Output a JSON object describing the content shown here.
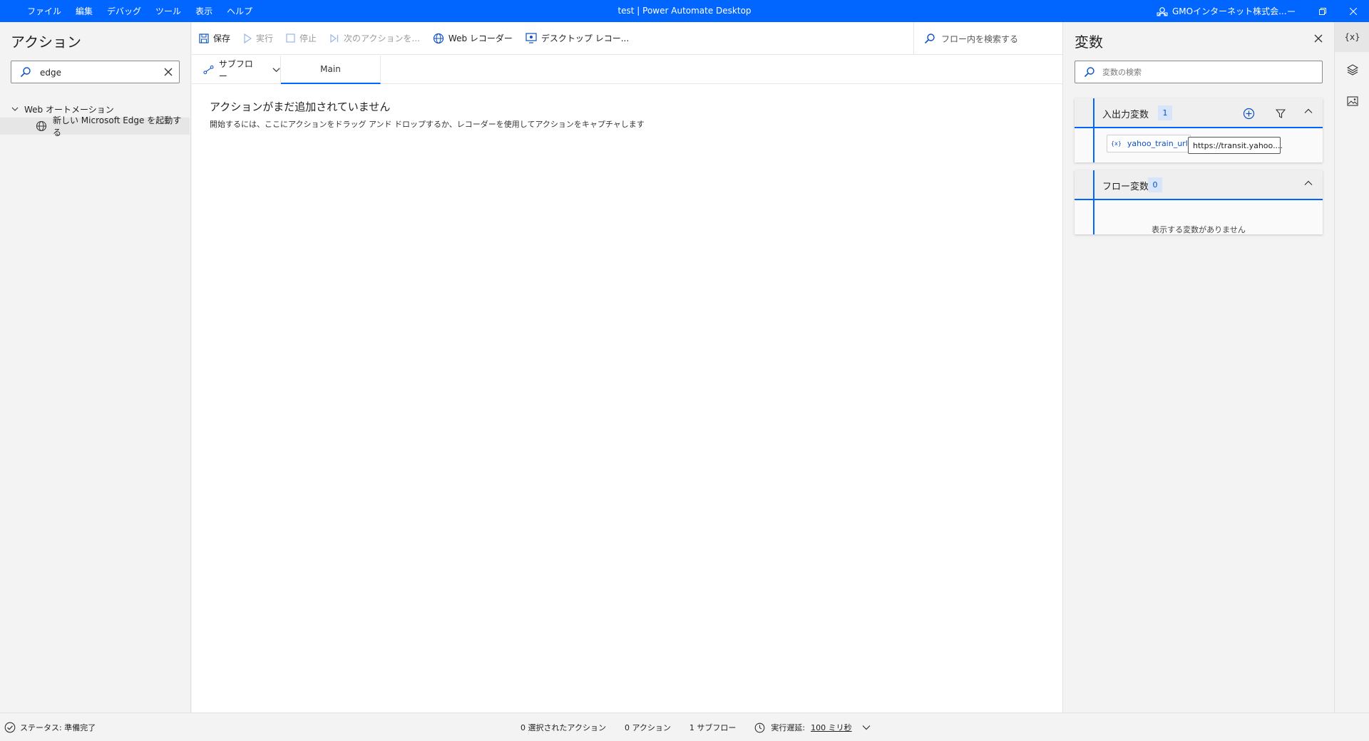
{
  "menu": [
    "ファイル",
    "編集",
    "デバッグ",
    "ツール",
    "表示",
    "ヘルプ"
  ],
  "window_title": "test | Power Automate Desktop",
  "org_name": "GMOインターネット株式会...",
  "actions_panel": {
    "title": "アクション",
    "search_value": "edge",
    "group_label": "Web オートメーション",
    "item_label": "新しい Microsoft Edge を起動する"
  },
  "toolbar": {
    "save": "保存",
    "run": "実行",
    "stop": "停止",
    "next_action": "次のアクションを...",
    "web_recorder": "Web レコーダー",
    "desktop_recorder": "デスクトップ レコー...",
    "flow_search_placeholder": "フロー内を検索する"
  },
  "tabs": {
    "subflow": "サブフロー",
    "main": "Main"
  },
  "canvas": {
    "empty_title": "アクションがまだ追加されていません",
    "empty_desc": "開始するには、ここにアクションをドラッグ アンド ドロップするか、レコーダーを使用してアクションをキャプチャします"
  },
  "variables_panel": {
    "title": "変数",
    "search_placeholder": "変数の検索",
    "io_section": {
      "title": "入出力変数",
      "count": "1"
    },
    "io_variable": {
      "icon_text": "{x}",
      "name": "yahoo_train_url",
      "value": "https://transit.yahoo...."
    },
    "flow_section": {
      "title": "フロー変数",
      "count": "0",
      "empty_text": "表示する変数がありません"
    }
  },
  "rail": {
    "variables_label": "{x}"
  },
  "status": {
    "status_text": "ステータス: 準備完了",
    "selected_actions": "0 選択されたアクション",
    "actions": "0 アクション",
    "subflows": "1 サブフロー",
    "delay_label": "実行遅延:",
    "delay_value": "100 ミリ秒"
  },
  "colors": {
    "accent": "#0066ff",
    "badge_bg": "#d7e5fb",
    "titlebar": "#0066ff"
  }
}
